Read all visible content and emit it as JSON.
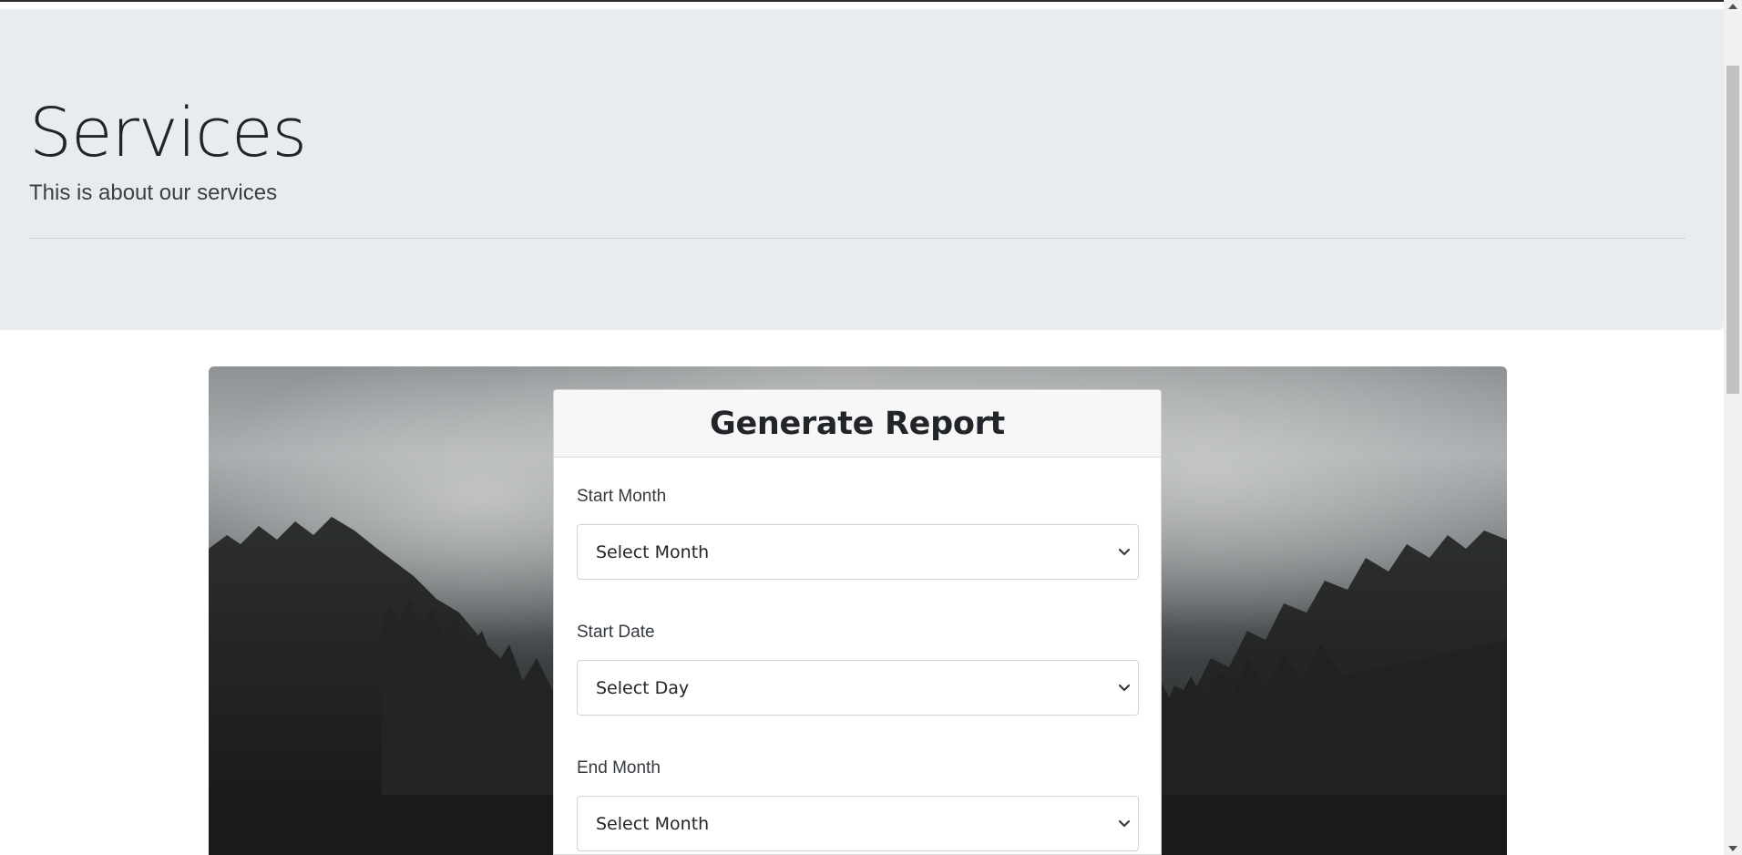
{
  "jumbotron": {
    "title": "Services",
    "lead": "This is about our services"
  },
  "report_form": {
    "title": "Generate Report",
    "fields": [
      {
        "label": "Start Month",
        "selected": "Select Month"
      },
      {
        "label": "Start Date",
        "selected": "Select Day"
      },
      {
        "label": "End Month",
        "selected": "Select Month"
      }
    ]
  },
  "colors": {
    "jumbotron_bg": "#e9ecef",
    "card_header_bg": "#f7f7f7",
    "text": "#212529"
  },
  "icons": [
    "chevron-down-icon",
    "scroll-up-arrow-icon",
    "scroll-down-arrow-icon"
  ]
}
